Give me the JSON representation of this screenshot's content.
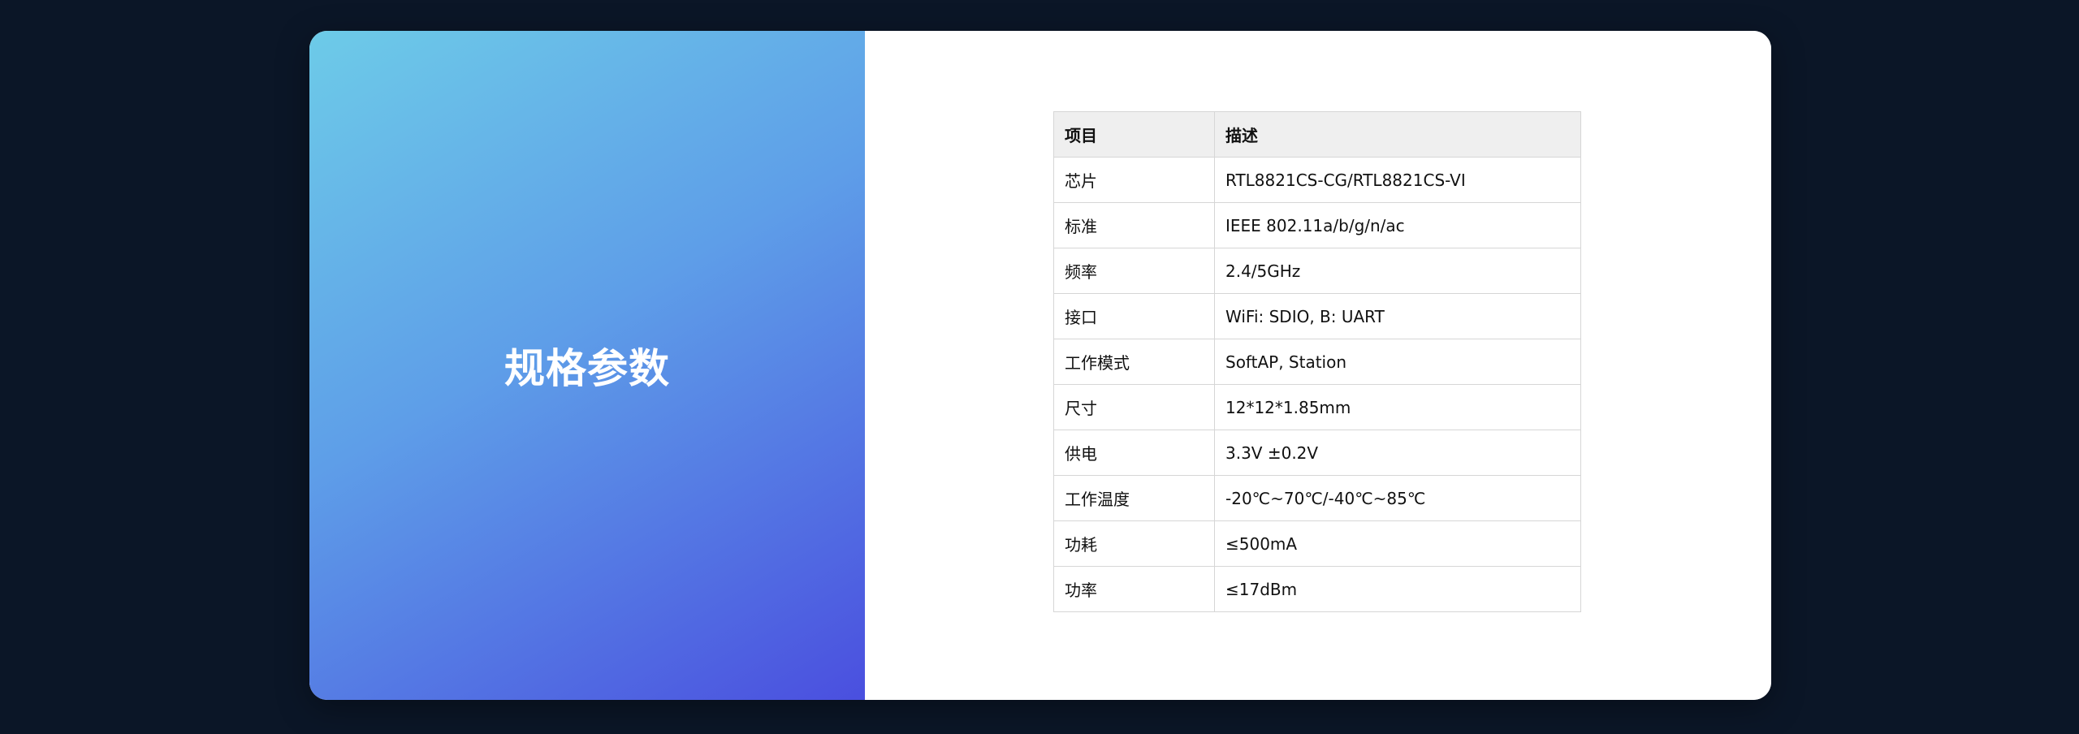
{
  "left_panel": {
    "title": "规格参数"
  },
  "spec_table": {
    "headers": [
      "项目",
      "描述"
    ],
    "rows": [
      [
        "芯片",
        "RTL8821CS-CG/RTL8821CS-VI"
      ],
      [
        "标准",
        "IEEE 802.11a/b/g/n/ac"
      ],
      [
        "频率",
        "2.4/5GHz"
      ],
      [
        "接口",
        "WiFi: SDIO, B: UART"
      ],
      [
        "工作模式",
        "SoftAP, Station"
      ],
      [
        "尺寸",
        "12*12*1.85mm"
      ],
      [
        "供电",
        "3.3V ±0.2V"
      ],
      [
        "工作温度",
        "-20℃~70℃/-40℃~85℃"
      ],
      [
        "功耗",
        "≤500mA"
      ],
      [
        "功率",
        "≤17dBm"
      ]
    ]
  },
  "colors": {
    "background": "#0b1627",
    "gradient_start": "#6dcbe8",
    "gradient_end": "#4a4fdf",
    "header_fill": "#efefef"
  }
}
